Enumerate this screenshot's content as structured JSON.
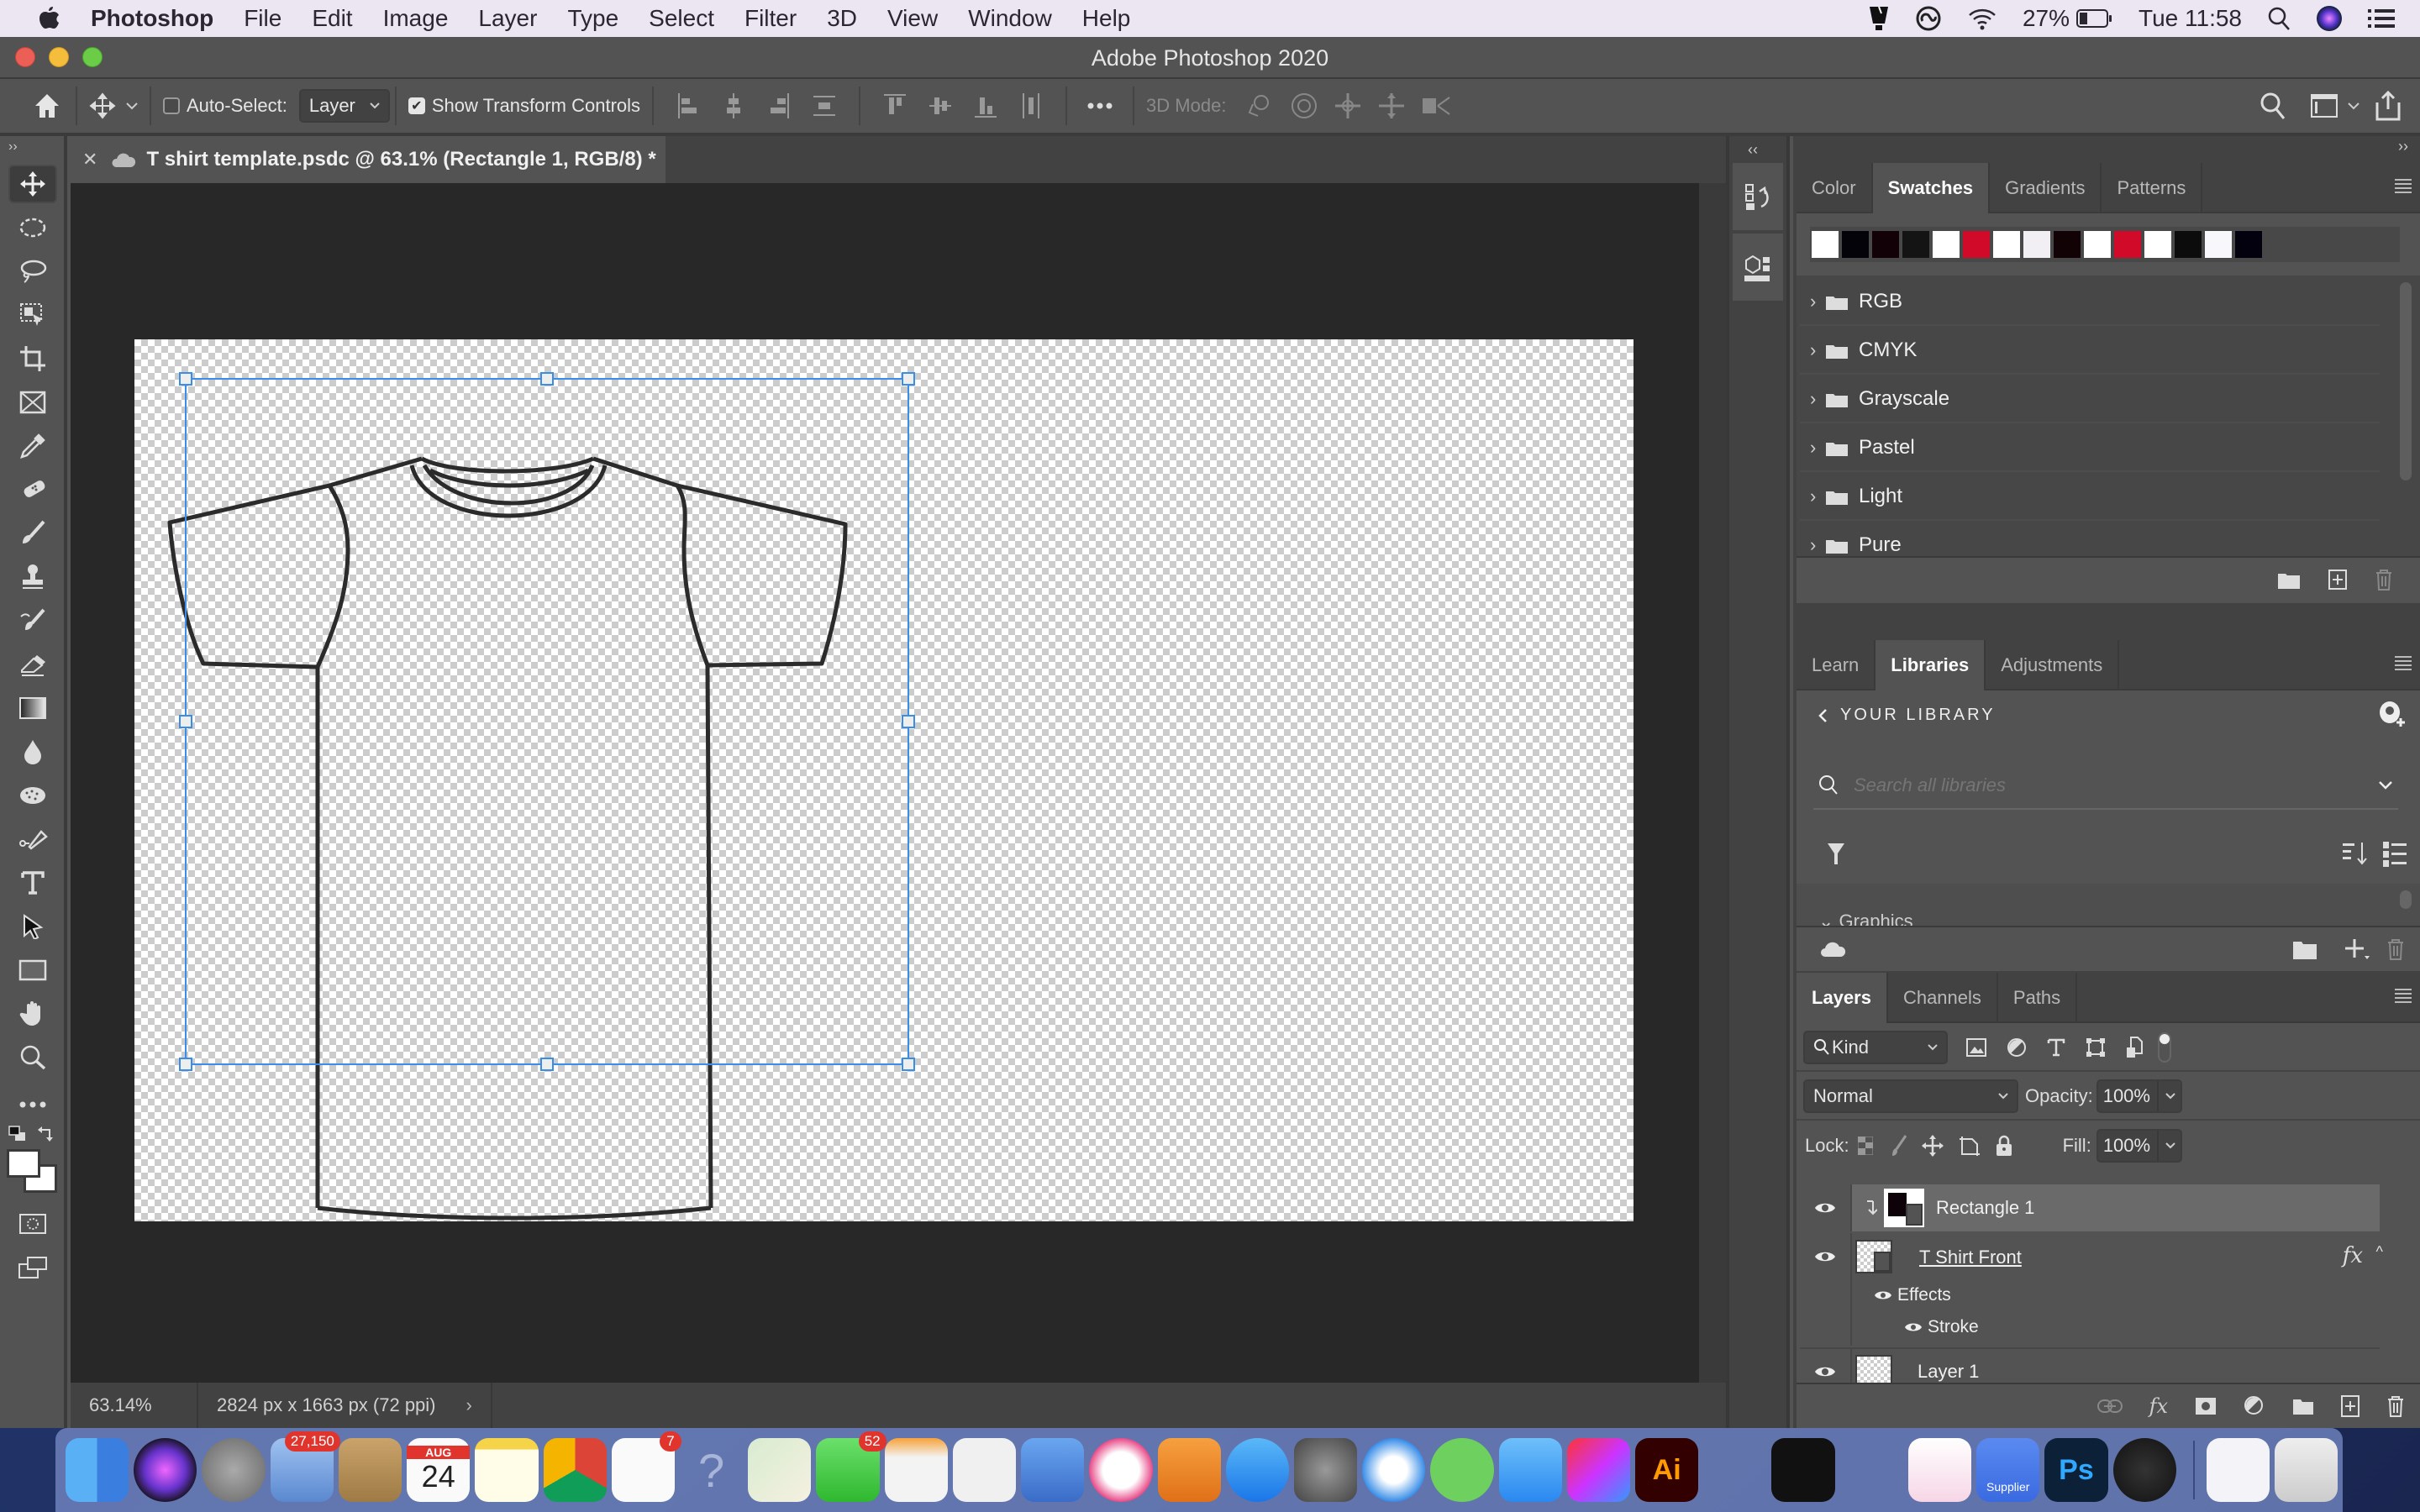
{
  "menubar": {
    "app": "Photoshop",
    "items": [
      "File",
      "Edit",
      "Image",
      "Layer",
      "Type",
      "Select",
      "Filter",
      "3D",
      "View",
      "Window",
      "Help"
    ],
    "battery": "27%",
    "clock": "Tue 11:58"
  },
  "window": {
    "title": "Adobe Photoshop 2020"
  },
  "options_bar": {
    "auto_select_label": "Auto-Select:",
    "auto_select_checked": false,
    "auto_select_target": "Layer",
    "show_transform_label": "Show Transform Controls",
    "show_transform_checked": true,
    "mode_3d_label": "3D Mode:"
  },
  "document": {
    "tab_title": "T shirt template.psdc @ 63.1% (Rectangle 1, RGB/8) *",
    "zoom": "63.14%",
    "dimensions": "2824 px x 1663 px (72 ppi)"
  },
  "tools": [
    "move",
    "elliptical-marquee",
    "lasso",
    "object-selection",
    "crop",
    "frame",
    "eyedropper",
    "healing-brush",
    "brush",
    "clone-stamp",
    "history-brush",
    "eraser",
    "gradient",
    "blur",
    "sponge",
    "pen",
    "type",
    "path-selection",
    "rectangle",
    "hand",
    "zoom",
    "more-tools"
  ],
  "swatches_panel": {
    "tabs": [
      "Color",
      "Swatches",
      "Gradients",
      "Patterns"
    ],
    "active_tab": "Swatches",
    "recent_swatches": [
      "#ffffff",
      "#05030a",
      "#120208",
      "#141414",
      "#ffffff",
      "#d20a2a",
      "#ffffff",
      "#f1eff3",
      "#100205",
      "#ffffff",
      "#d20a2a",
      "#ffffff",
      "#0c0c0c",
      "#f8f7fc",
      "#03010e"
    ],
    "groups": [
      "RGB",
      "CMYK",
      "Grayscale",
      "Pastel",
      "Light",
      "Pure"
    ]
  },
  "libraries_panel": {
    "tabs": [
      "Learn",
      "Libraries",
      "Adjustments"
    ],
    "active_tab": "Libraries",
    "breadcrumb": "YOUR LIBRARY",
    "search_placeholder": "Search all libraries",
    "section": "Graphics"
  },
  "layers_panel": {
    "tabs": [
      "Layers",
      "Channels",
      "Paths"
    ],
    "active_tab": "Layers",
    "filter_kind": "Kind",
    "blend_mode": "Normal",
    "opacity_label": "Opacity:",
    "opacity": "100%",
    "lock_label": "Lock:",
    "fill_label": "Fill:",
    "fill": "100%",
    "layers": [
      {
        "name": "Rectangle 1",
        "selected": true,
        "visible": true,
        "clipped": true
      },
      {
        "name": "T Shirt Front",
        "selected": false,
        "visible": true,
        "fx": "fx",
        "effects_label": "Effects",
        "effects": [
          "Stroke"
        ]
      },
      {
        "name": "Layer 1",
        "selected": false,
        "visible": true
      }
    ]
  },
  "dock": {
    "apps": [
      {
        "name": "Finder",
        "running": true
      },
      {
        "name": "Siri"
      },
      {
        "name": "Launchpad"
      },
      {
        "name": "Mail",
        "badge": "27,150",
        "running": true
      },
      {
        "name": "Contacts"
      },
      {
        "name": "Calendar",
        "month": "AUG",
        "day": "24"
      },
      {
        "name": "Notes"
      },
      {
        "name": "Chrome",
        "running": true
      },
      {
        "name": "Reminders",
        "badge": "7"
      },
      {
        "name": "Help"
      },
      {
        "name": "Maps"
      },
      {
        "name": "FaceTime",
        "badge": "52"
      },
      {
        "name": "Pages"
      },
      {
        "name": "Numbers"
      },
      {
        "name": "Keynote"
      },
      {
        "name": "iTunes",
        "running": true
      },
      {
        "name": "Books"
      },
      {
        "name": "App Store"
      },
      {
        "name": "System Preferences"
      },
      {
        "name": "Safari",
        "running": true
      },
      {
        "name": "Spotify",
        "running": true
      },
      {
        "name": "Messages",
        "running": true
      },
      {
        "name": "Creative Cloud"
      },
      {
        "name": "Illustrator",
        "label": "Ai"
      },
      {
        "name": "System Information"
      },
      {
        "name": "Deezer"
      },
      {
        "name": "Keychain Access"
      },
      {
        "name": "CleanMyMac"
      },
      {
        "name": "Supplier",
        "label": "Supplier"
      },
      {
        "name": "Photoshop",
        "label": "Ps",
        "running": true
      },
      {
        "name": "Audio App",
        "running": true
      },
      {
        "name": "Downloads Stack"
      },
      {
        "name": "Trash"
      }
    ]
  }
}
